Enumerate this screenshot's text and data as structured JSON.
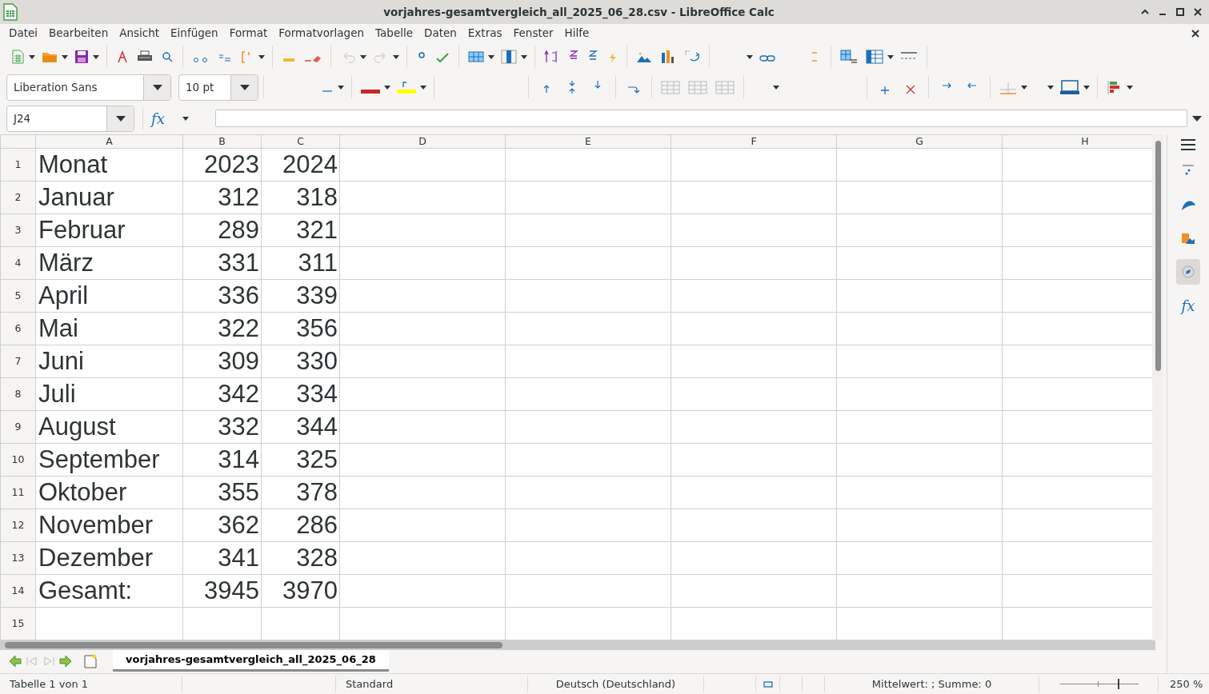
{
  "window": {
    "title": "vorjahres-gesamtvergleich_all_2025_06_28.csv - LibreOffice Calc"
  },
  "menu": [
    "Datei",
    "Bearbeiten",
    "Ansicht",
    "Einfügen",
    "Format",
    "Formatvorlagen",
    "Tabelle",
    "Daten",
    "Extras",
    "Fenster",
    "Hilfe"
  ],
  "toolbar": {
    "undo": {
      "disabled": true
    },
    "redo": {
      "disabled": true
    }
  },
  "formatting": {
    "font_name": "Liberation Sans",
    "font_size": "10 pt"
  },
  "formula_bar": {
    "name_box": "J24",
    "function_wizard": "fx"
  },
  "sheet": {
    "columns": [
      "A",
      "B",
      "C",
      "D",
      "E",
      "F",
      "G",
      "H"
    ],
    "rows": [
      {
        "number": "1",
        "cells": [
          "Monat",
          "2023",
          "2024"
        ]
      },
      {
        "number": "2",
        "cells": [
          "Januar",
          "312",
          "318"
        ]
      },
      {
        "number": "3",
        "cells": [
          "Februar",
          "289",
          "321"
        ]
      },
      {
        "number": "4",
        "cells": [
          "März",
          "331",
          "311"
        ]
      },
      {
        "number": "5",
        "cells": [
          "April",
          "336",
          "339"
        ]
      },
      {
        "number": "6",
        "cells": [
          "Mai",
          "322",
          "356"
        ]
      },
      {
        "number": "7",
        "cells": [
          "Juni",
          "309",
          "330"
        ]
      },
      {
        "number": "8",
        "cells": [
          "Juli",
          "342",
          "334"
        ]
      },
      {
        "number": "9",
        "cells": [
          "August",
          "332",
          "344"
        ]
      },
      {
        "number": "10",
        "cells": [
          "September",
          "314",
          "325"
        ]
      },
      {
        "number": "11",
        "cells": [
          "Oktober",
          "355",
          "378"
        ]
      },
      {
        "number": "12",
        "cells": [
          "November",
          "362",
          "286"
        ]
      },
      {
        "number": "13",
        "cells": [
          "Dezember",
          "341",
          "328"
        ]
      },
      {
        "number": "14",
        "cells": [
          "Gesamt:",
          "3945",
          "3970"
        ]
      },
      {
        "number": "15"
      }
    ]
  },
  "sheet_tabs": [
    {
      "label": "vorjahres-gesamtvergleich_all_2025_06_28",
      "selected": true
    }
  ],
  "sidebar": {
    "items": [
      {
        "kind": "properties",
        "selected": false
      },
      {
        "kind": "styles",
        "selected": false
      },
      {
        "kind": "gallery",
        "selected": false
      },
      {
        "kind": "navigator",
        "selected": true
      },
      {
        "kind": "functions",
        "label": "fx",
        "selected": false
      }
    ]
  },
  "status_bar": {
    "sheet_position": "Tabelle 1 von 1",
    "page_style": "Standard",
    "language": "Deutsch (Deutschland)",
    "selection_summary": "Mittelwert: ; Summe: 0",
    "zoom": {
      "level": 0.75,
      "reading": "250 %"
    }
  }
}
